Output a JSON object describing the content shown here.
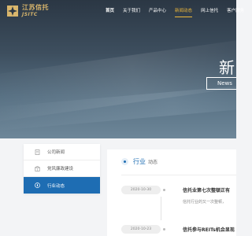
{
  "brand": {
    "name_cn": "江苏信托",
    "name_en": "JSITC"
  },
  "nav": {
    "items": [
      {
        "label": "首页",
        "bold": true
      },
      {
        "label": "关于我们"
      },
      {
        "label": "产品中心"
      },
      {
        "label": "新闻动态",
        "active": true
      },
      {
        "label": "网上信托"
      },
      {
        "label": "客户服务"
      }
    ]
  },
  "hero": {
    "title": "新",
    "news_label": "News"
  },
  "sidebar": {
    "items": [
      {
        "label": "公司新闻",
        "icon": "document-icon"
      },
      {
        "label": "党风廉政建设",
        "icon": "building-icon"
      },
      {
        "label": "行业动态",
        "icon": "compass-icon",
        "active": true
      }
    ]
  },
  "section": {
    "title": "行业",
    "subtitle": "动态"
  },
  "news": [
    {
      "date": "2020-10-30",
      "title": "信托业第七次整顿正有",
      "desc": "信托行业的又一次整顿，"
    },
    {
      "date": "2020-10-23",
      "title": "信托参与REITs机会显现"
    }
  ],
  "colors": {
    "accent": "#1e6db3",
    "nav_active": "#f0b93a",
    "brand_gold": "#d9b66c"
  }
}
